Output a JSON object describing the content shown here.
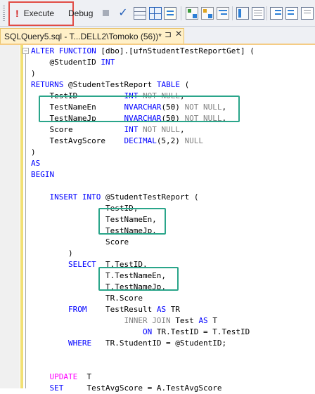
{
  "toolbar": {
    "execute_label": "Execute",
    "execute_glyph": "!",
    "debug_label": "Debug",
    "icons": [
      "stop-icon",
      "parse-check-icon",
      "results-to-grid-icon",
      "results-grid-icon",
      "results-to-file-icon",
      "query-plan-icon",
      "client-stats-icon",
      "include-stats-icon",
      "results-tab-icon",
      "text-results-icon",
      "indent-icon",
      "outdent-icon",
      "more-options-icon"
    ]
  },
  "tab": {
    "title": "SQLQuery5.sql - T...DELL2\\Tomoko (56))*",
    "pin_glyph": "⊐",
    "close_glyph": "✕"
  },
  "colors": {
    "keyword": "#0000ff",
    "function": "#ff00ff",
    "gray": "#808080",
    "highlight_execute": "#e14c46",
    "highlight_box": "#2aa58a",
    "tab_active": "#fff0c8"
  },
  "code": [
    [
      [
        "kw",
        "ALTER FUNCTION "
      ],
      [
        "p",
        "[dbo].[ufnStudentTestReportGet] ("
      ]
    ],
    [
      [
        "p",
        "    @StudentID "
      ],
      [
        "kw",
        "INT"
      ]
    ],
    [
      [
        "p",
        ")"
      ]
    ],
    [
      [
        "kw",
        "RETURNS "
      ],
      [
        "p",
        "@StudentTestReport "
      ],
      [
        "kw",
        "TABLE "
      ],
      [
        "p",
        "("
      ]
    ],
    [
      [
        "p",
        "    TestID          "
      ],
      [
        "kw",
        "INT "
      ],
      [
        "g",
        "NOT NULL"
      ],
      [
        "p",
        ","
      ]
    ],
    [
      [
        "p",
        "    TestNameEn      "
      ],
      [
        "kw",
        "NVARCHAR"
      ],
      [
        "p",
        "(50) "
      ],
      [
        "g",
        "NOT NULL"
      ],
      [
        "p",
        ","
      ]
    ],
    [
      [
        "p",
        "    TestNameJp      "
      ],
      [
        "kw",
        "NVARCHAR"
      ],
      [
        "p",
        "(50) "
      ],
      [
        "g",
        "NOT NULL"
      ],
      [
        "p",
        ","
      ]
    ],
    [
      [
        "p",
        "    Score           "
      ],
      [
        "kw",
        "INT "
      ],
      [
        "g",
        "NOT NULL"
      ],
      [
        "p",
        ","
      ]
    ],
    [
      [
        "p",
        "    TestAvgScore    "
      ],
      [
        "kw",
        "DECIMAL"
      ],
      [
        "p",
        "(5,2) "
      ],
      [
        "g",
        "NULL"
      ]
    ],
    [
      [
        "p",
        ")"
      ]
    ],
    [
      [
        "kw",
        "AS"
      ]
    ],
    [
      [
        "kw",
        "BEGIN"
      ]
    ],
    [],
    [
      [
        "p",
        "    "
      ],
      [
        "kw",
        "INSERT INTO "
      ],
      [
        "p",
        "@StudentTestReport ("
      ]
    ],
    [
      [
        "p",
        "                TestID,"
      ]
    ],
    [
      [
        "p",
        "                TestNameEn,"
      ]
    ],
    [
      [
        "p",
        "                TestNameJp,"
      ]
    ],
    [
      [
        "p",
        "                Score"
      ]
    ],
    [
      [
        "p",
        "        )"
      ]
    ],
    [
      [
        "p",
        "        "
      ],
      [
        "kw",
        "SELECT  "
      ],
      [
        "p",
        "T.TestID,"
      ]
    ],
    [
      [
        "p",
        "                T.TestNameEn,"
      ]
    ],
    [
      [
        "p",
        "                T.TestNameJp,"
      ]
    ],
    [
      [
        "p",
        "                TR.Score"
      ]
    ],
    [
      [
        "p",
        "        "
      ],
      [
        "kw",
        "FROM    "
      ],
      [
        "p",
        "TestResult "
      ],
      [
        "kw",
        "AS "
      ],
      [
        "p",
        "TR"
      ]
    ],
    [
      [
        "p",
        "                    "
      ],
      [
        "g",
        "INNER JOIN "
      ],
      [
        "p",
        "Test "
      ],
      [
        "kw",
        "AS "
      ],
      [
        "p",
        "T"
      ]
    ],
    [
      [
        "p",
        "                        "
      ],
      [
        "kw",
        "ON "
      ],
      [
        "p",
        "TR.TestID = T.TestID"
      ]
    ],
    [
      [
        "p",
        "        "
      ],
      [
        "kw",
        "WHERE   "
      ],
      [
        "p",
        "TR.StudentID = @StudentID;"
      ]
    ],
    [],
    [],
    [
      [
        "p",
        "    "
      ],
      [
        "fn",
        "UPDATE  "
      ],
      [
        "p",
        "T"
      ]
    ],
    [
      [
        "p",
        "    "
      ],
      [
        "kw",
        "SET     "
      ],
      [
        "p",
        "TestAvgScore = A.TestAvgScore"
      ]
    ]
  ]
}
